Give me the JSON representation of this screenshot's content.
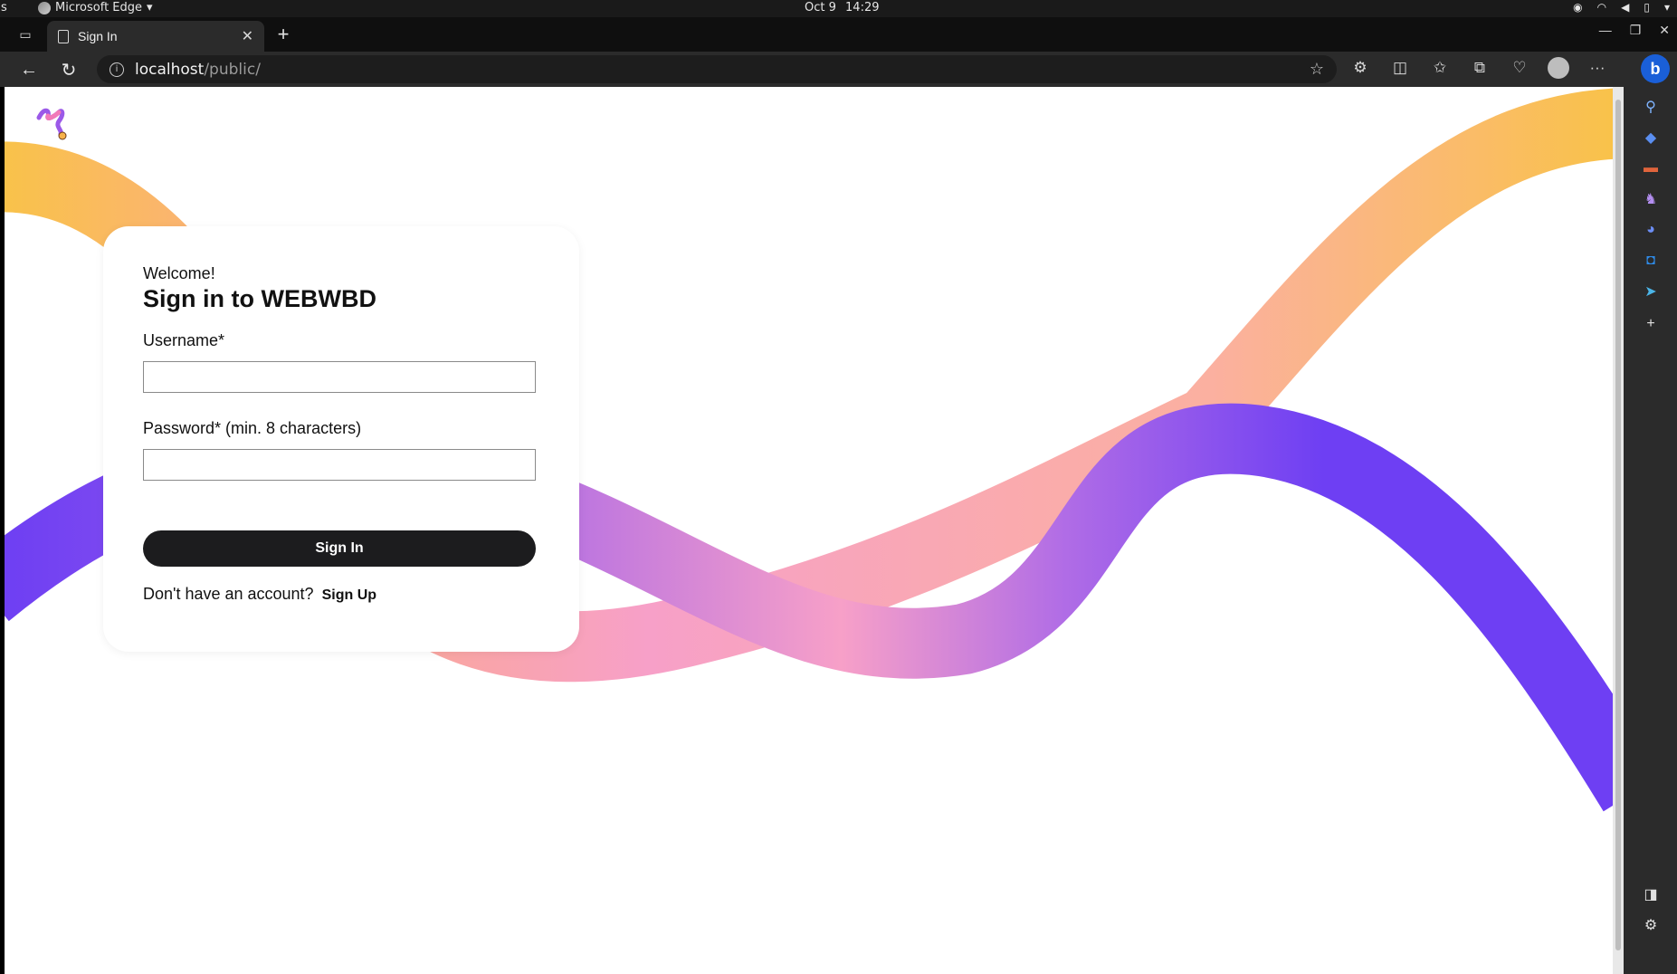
{
  "os": {
    "left_cut": "s",
    "app_name": "Microsoft Edge",
    "date": "Oct 9",
    "time": "14:29"
  },
  "browser": {
    "tab_title": "Sign In",
    "url_host": "localhost",
    "url_path": "/public/"
  },
  "page": {
    "welcome": "Welcome!",
    "heading": "Sign in to WEBWBD",
    "username_label": "Username*",
    "password_label": "Password* (min. 8 characters)",
    "username_value": "",
    "password_value": "",
    "signin_button": "Sign In",
    "no_account_text": "Don't have an account?",
    "signup_link": "Sign Up"
  },
  "colors": {
    "wave_yellow": "#F9C24A",
    "wave_peach": "#FBA98E",
    "wave_pink": "#F7A0C8",
    "wave_violet": "#C27AE0",
    "wave_purple": "#6E3FF3",
    "button_bg": "#1C1C1E"
  },
  "icons": {
    "sidebar": [
      "search-icon",
      "tag-icon",
      "toolbox-icon",
      "chess-icon",
      "copilot-icon",
      "outlook-icon",
      "send-icon",
      "add-icon",
      "split-icon",
      "settings-icon"
    ],
    "toolbar": [
      "extensions-icon",
      "split-screen-icon",
      "favorites-icon",
      "collections-icon",
      "performance-icon",
      "profile-icon",
      "more-icon"
    ]
  }
}
